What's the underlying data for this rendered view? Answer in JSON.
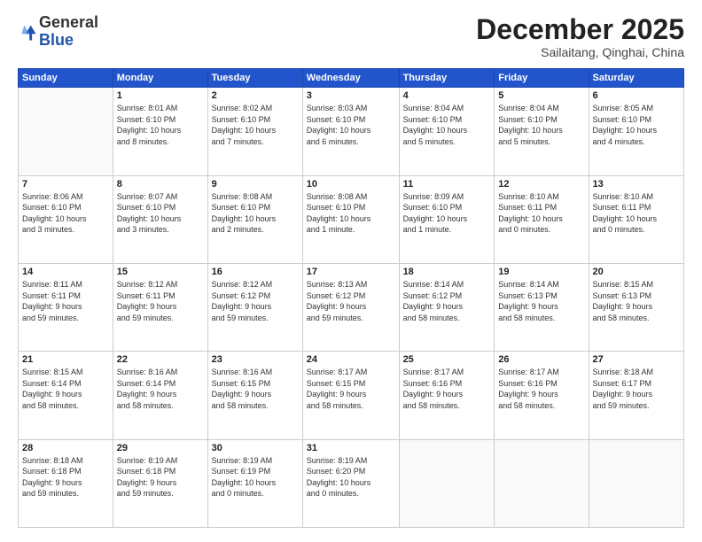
{
  "header": {
    "logo_general": "General",
    "logo_blue": "Blue",
    "month": "December 2025",
    "location": "Sailaitang, Qinghai, China"
  },
  "days_of_week": [
    "Sunday",
    "Monday",
    "Tuesday",
    "Wednesday",
    "Thursday",
    "Friday",
    "Saturday"
  ],
  "weeks": [
    [
      {
        "num": "",
        "info": ""
      },
      {
        "num": "1",
        "info": "Sunrise: 8:01 AM\nSunset: 6:10 PM\nDaylight: 10 hours\nand 8 minutes."
      },
      {
        "num": "2",
        "info": "Sunrise: 8:02 AM\nSunset: 6:10 PM\nDaylight: 10 hours\nand 7 minutes."
      },
      {
        "num": "3",
        "info": "Sunrise: 8:03 AM\nSunset: 6:10 PM\nDaylight: 10 hours\nand 6 minutes."
      },
      {
        "num": "4",
        "info": "Sunrise: 8:04 AM\nSunset: 6:10 PM\nDaylight: 10 hours\nand 5 minutes."
      },
      {
        "num": "5",
        "info": "Sunrise: 8:04 AM\nSunset: 6:10 PM\nDaylight: 10 hours\nand 5 minutes."
      },
      {
        "num": "6",
        "info": "Sunrise: 8:05 AM\nSunset: 6:10 PM\nDaylight: 10 hours\nand 4 minutes."
      }
    ],
    [
      {
        "num": "7",
        "info": "Sunrise: 8:06 AM\nSunset: 6:10 PM\nDaylight: 10 hours\nand 3 minutes."
      },
      {
        "num": "8",
        "info": "Sunrise: 8:07 AM\nSunset: 6:10 PM\nDaylight: 10 hours\nand 3 minutes."
      },
      {
        "num": "9",
        "info": "Sunrise: 8:08 AM\nSunset: 6:10 PM\nDaylight: 10 hours\nand 2 minutes."
      },
      {
        "num": "10",
        "info": "Sunrise: 8:08 AM\nSunset: 6:10 PM\nDaylight: 10 hours\nand 1 minute."
      },
      {
        "num": "11",
        "info": "Sunrise: 8:09 AM\nSunset: 6:10 PM\nDaylight: 10 hours\nand 1 minute."
      },
      {
        "num": "12",
        "info": "Sunrise: 8:10 AM\nSunset: 6:11 PM\nDaylight: 10 hours\nand 0 minutes."
      },
      {
        "num": "13",
        "info": "Sunrise: 8:10 AM\nSunset: 6:11 PM\nDaylight: 10 hours\nand 0 minutes."
      }
    ],
    [
      {
        "num": "14",
        "info": "Sunrise: 8:11 AM\nSunset: 6:11 PM\nDaylight: 9 hours\nand 59 minutes."
      },
      {
        "num": "15",
        "info": "Sunrise: 8:12 AM\nSunset: 6:11 PM\nDaylight: 9 hours\nand 59 minutes."
      },
      {
        "num": "16",
        "info": "Sunrise: 8:12 AM\nSunset: 6:12 PM\nDaylight: 9 hours\nand 59 minutes."
      },
      {
        "num": "17",
        "info": "Sunrise: 8:13 AM\nSunset: 6:12 PM\nDaylight: 9 hours\nand 59 minutes."
      },
      {
        "num": "18",
        "info": "Sunrise: 8:14 AM\nSunset: 6:12 PM\nDaylight: 9 hours\nand 58 minutes."
      },
      {
        "num": "19",
        "info": "Sunrise: 8:14 AM\nSunset: 6:13 PM\nDaylight: 9 hours\nand 58 minutes."
      },
      {
        "num": "20",
        "info": "Sunrise: 8:15 AM\nSunset: 6:13 PM\nDaylight: 9 hours\nand 58 minutes."
      }
    ],
    [
      {
        "num": "21",
        "info": "Sunrise: 8:15 AM\nSunset: 6:14 PM\nDaylight: 9 hours\nand 58 minutes."
      },
      {
        "num": "22",
        "info": "Sunrise: 8:16 AM\nSunset: 6:14 PM\nDaylight: 9 hours\nand 58 minutes."
      },
      {
        "num": "23",
        "info": "Sunrise: 8:16 AM\nSunset: 6:15 PM\nDaylight: 9 hours\nand 58 minutes."
      },
      {
        "num": "24",
        "info": "Sunrise: 8:17 AM\nSunset: 6:15 PM\nDaylight: 9 hours\nand 58 minutes."
      },
      {
        "num": "25",
        "info": "Sunrise: 8:17 AM\nSunset: 6:16 PM\nDaylight: 9 hours\nand 58 minutes."
      },
      {
        "num": "26",
        "info": "Sunrise: 8:17 AM\nSunset: 6:16 PM\nDaylight: 9 hours\nand 58 minutes."
      },
      {
        "num": "27",
        "info": "Sunrise: 8:18 AM\nSunset: 6:17 PM\nDaylight: 9 hours\nand 59 minutes."
      }
    ],
    [
      {
        "num": "28",
        "info": "Sunrise: 8:18 AM\nSunset: 6:18 PM\nDaylight: 9 hours\nand 59 minutes."
      },
      {
        "num": "29",
        "info": "Sunrise: 8:19 AM\nSunset: 6:18 PM\nDaylight: 9 hours\nand 59 minutes."
      },
      {
        "num": "30",
        "info": "Sunrise: 8:19 AM\nSunset: 6:19 PM\nDaylight: 10 hours\nand 0 minutes."
      },
      {
        "num": "31",
        "info": "Sunrise: 8:19 AM\nSunset: 6:20 PM\nDaylight: 10 hours\nand 0 minutes."
      },
      {
        "num": "",
        "info": ""
      },
      {
        "num": "",
        "info": ""
      },
      {
        "num": "",
        "info": ""
      }
    ]
  ]
}
